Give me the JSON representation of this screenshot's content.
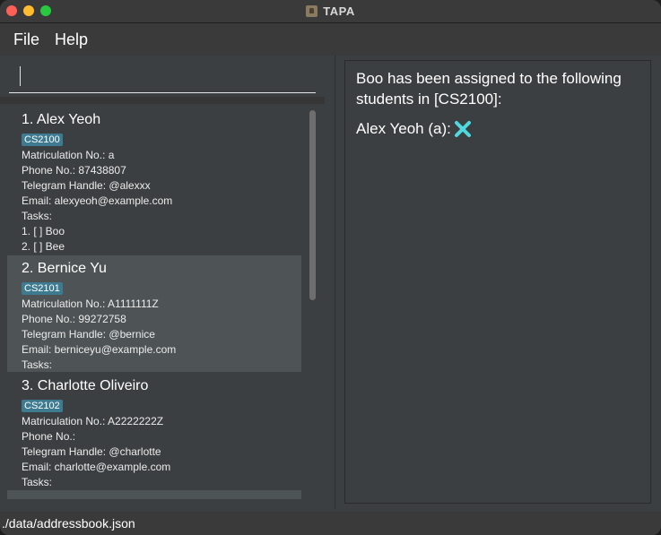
{
  "window": {
    "title": "TAPA",
    "app_icon": "person-icon"
  },
  "menubar": {
    "file": "File",
    "help": "Help"
  },
  "command": {
    "value": ""
  },
  "students": [
    {
      "index_name": "1.  Alex Yeoh",
      "tag": "CS2100",
      "matric": "Matriculation No.: a",
      "phone": "Phone No.: 87438807",
      "telegram": "Telegram Handle: @alexxx",
      "email": "Email: alexyeoh@example.com",
      "tasks_label": "Tasks:",
      "tasks": [
        "1. [ ] Boo",
        "2. [ ] Bee"
      ]
    },
    {
      "index_name": "2.  Bernice Yu",
      "tag": "CS2101",
      "matric": "Matriculation No.: A1111111Z",
      "phone": "Phone No.: 99272758",
      "telegram": "Telegram Handle: @bernice",
      "email": "Email: berniceyu@example.com",
      "tasks_label": "Tasks:",
      "tasks": []
    },
    {
      "index_name": "3.  Charlotte Oliveiro",
      "tag": "CS2102",
      "matric": "Matriculation No.: A2222222Z",
      "phone": "Phone No.:",
      "telegram": "Telegram Handle: @charlotte",
      "email": "Email: charlotte@example.com",
      "tasks_label": "Tasks:",
      "tasks": []
    }
  ],
  "result": {
    "message": "Boo has been assigned to the following students in [CS2100]:",
    "line": "Alex Yeoh (a):",
    "status_icon": "cross-icon",
    "status_color": "#4fd8e0"
  },
  "statusbar": {
    "path": "./data/addressbook.json"
  },
  "colors": {
    "tag": "#3e7b91",
    "selected_card": "#4e5355",
    "background": "#3c3f41"
  }
}
